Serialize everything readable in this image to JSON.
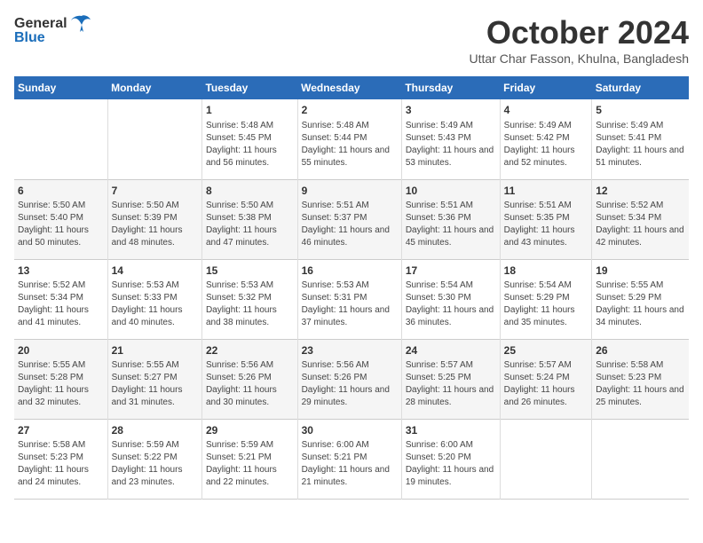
{
  "logo": {
    "general": "General",
    "blue": "Blue"
  },
  "title": "October 2024",
  "subtitle": "Uttar Char Fasson, Khulna, Bangladesh",
  "weekdays": [
    "Sunday",
    "Monday",
    "Tuesday",
    "Wednesday",
    "Thursday",
    "Friday",
    "Saturday"
  ],
  "weeks": [
    [
      {
        "day": "",
        "info": ""
      },
      {
        "day": "",
        "info": ""
      },
      {
        "day": "1",
        "info": "Sunrise: 5:48 AM\nSunset: 5:45 PM\nDaylight: 11 hours and 56 minutes."
      },
      {
        "day": "2",
        "info": "Sunrise: 5:48 AM\nSunset: 5:44 PM\nDaylight: 11 hours and 55 minutes."
      },
      {
        "day": "3",
        "info": "Sunrise: 5:49 AM\nSunset: 5:43 PM\nDaylight: 11 hours and 53 minutes."
      },
      {
        "day": "4",
        "info": "Sunrise: 5:49 AM\nSunset: 5:42 PM\nDaylight: 11 hours and 52 minutes."
      },
      {
        "day": "5",
        "info": "Sunrise: 5:49 AM\nSunset: 5:41 PM\nDaylight: 11 hours and 51 minutes."
      }
    ],
    [
      {
        "day": "6",
        "info": "Sunrise: 5:50 AM\nSunset: 5:40 PM\nDaylight: 11 hours and 50 minutes."
      },
      {
        "day": "7",
        "info": "Sunrise: 5:50 AM\nSunset: 5:39 PM\nDaylight: 11 hours and 48 minutes."
      },
      {
        "day": "8",
        "info": "Sunrise: 5:50 AM\nSunset: 5:38 PM\nDaylight: 11 hours and 47 minutes."
      },
      {
        "day": "9",
        "info": "Sunrise: 5:51 AM\nSunset: 5:37 PM\nDaylight: 11 hours and 46 minutes."
      },
      {
        "day": "10",
        "info": "Sunrise: 5:51 AM\nSunset: 5:36 PM\nDaylight: 11 hours and 45 minutes."
      },
      {
        "day": "11",
        "info": "Sunrise: 5:51 AM\nSunset: 5:35 PM\nDaylight: 11 hours and 43 minutes."
      },
      {
        "day": "12",
        "info": "Sunrise: 5:52 AM\nSunset: 5:34 PM\nDaylight: 11 hours and 42 minutes."
      }
    ],
    [
      {
        "day": "13",
        "info": "Sunrise: 5:52 AM\nSunset: 5:34 PM\nDaylight: 11 hours and 41 minutes."
      },
      {
        "day": "14",
        "info": "Sunrise: 5:53 AM\nSunset: 5:33 PM\nDaylight: 11 hours and 40 minutes."
      },
      {
        "day": "15",
        "info": "Sunrise: 5:53 AM\nSunset: 5:32 PM\nDaylight: 11 hours and 38 minutes."
      },
      {
        "day": "16",
        "info": "Sunrise: 5:53 AM\nSunset: 5:31 PM\nDaylight: 11 hours and 37 minutes."
      },
      {
        "day": "17",
        "info": "Sunrise: 5:54 AM\nSunset: 5:30 PM\nDaylight: 11 hours and 36 minutes."
      },
      {
        "day": "18",
        "info": "Sunrise: 5:54 AM\nSunset: 5:29 PM\nDaylight: 11 hours and 35 minutes."
      },
      {
        "day": "19",
        "info": "Sunrise: 5:55 AM\nSunset: 5:29 PM\nDaylight: 11 hours and 34 minutes."
      }
    ],
    [
      {
        "day": "20",
        "info": "Sunrise: 5:55 AM\nSunset: 5:28 PM\nDaylight: 11 hours and 32 minutes."
      },
      {
        "day": "21",
        "info": "Sunrise: 5:55 AM\nSunset: 5:27 PM\nDaylight: 11 hours and 31 minutes."
      },
      {
        "day": "22",
        "info": "Sunrise: 5:56 AM\nSunset: 5:26 PM\nDaylight: 11 hours and 30 minutes."
      },
      {
        "day": "23",
        "info": "Sunrise: 5:56 AM\nSunset: 5:26 PM\nDaylight: 11 hours and 29 minutes."
      },
      {
        "day": "24",
        "info": "Sunrise: 5:57 AM\nSunset: 5:25 PM\nDaylight: 11 hours and 28 minutes."
      },
      {
        "day": "25",
        "info": "Sunrise: 5:57 AM\nSunset: 5:24 PM\nDaylight: 11 hours and 26 minutes."
      },
      {
        "day": "26",
        "info": "Sunrise: 5:58 AM\nSunset: 5:23 PM\nDaylight: 11 hours and 25 minutes."
      }
    ],
    [
      {
        "day": "27",
        "info": "Sunrise: 5:58 AM\nSunset: 5:23 PM\nDaylight: 11 hours and 24 minutes."
      },
      {
        "day": "28",
        "info": "Sunrise: 5:59 AM\nSunset: 5:22 PM\nDaylight: 11 hours and 23 minutes."
      },
      {
        "day": "29",
        "info": "Sunrise: 5:59 AM\nSunset: 5:21 PM\nDaylight: 11 hours and 22 minutes."
      },
      {
        "day": "30",
        "info": "Sunrise: 6:00 AM\nSunset: 5:21 PM\nDaylight: 11 hours and 21 minutes."
      },
      {
        "day": "31",
        "info": "Sunrise: 6:00 AM\nSunset: 5:20 PM\nDaylight: 11 hours and 19 minutes."
      },
      {
        "day": "",
        "info": ""
      },
      {
        "day": "",
        "info": ""
      }
    ]
  ]
}
